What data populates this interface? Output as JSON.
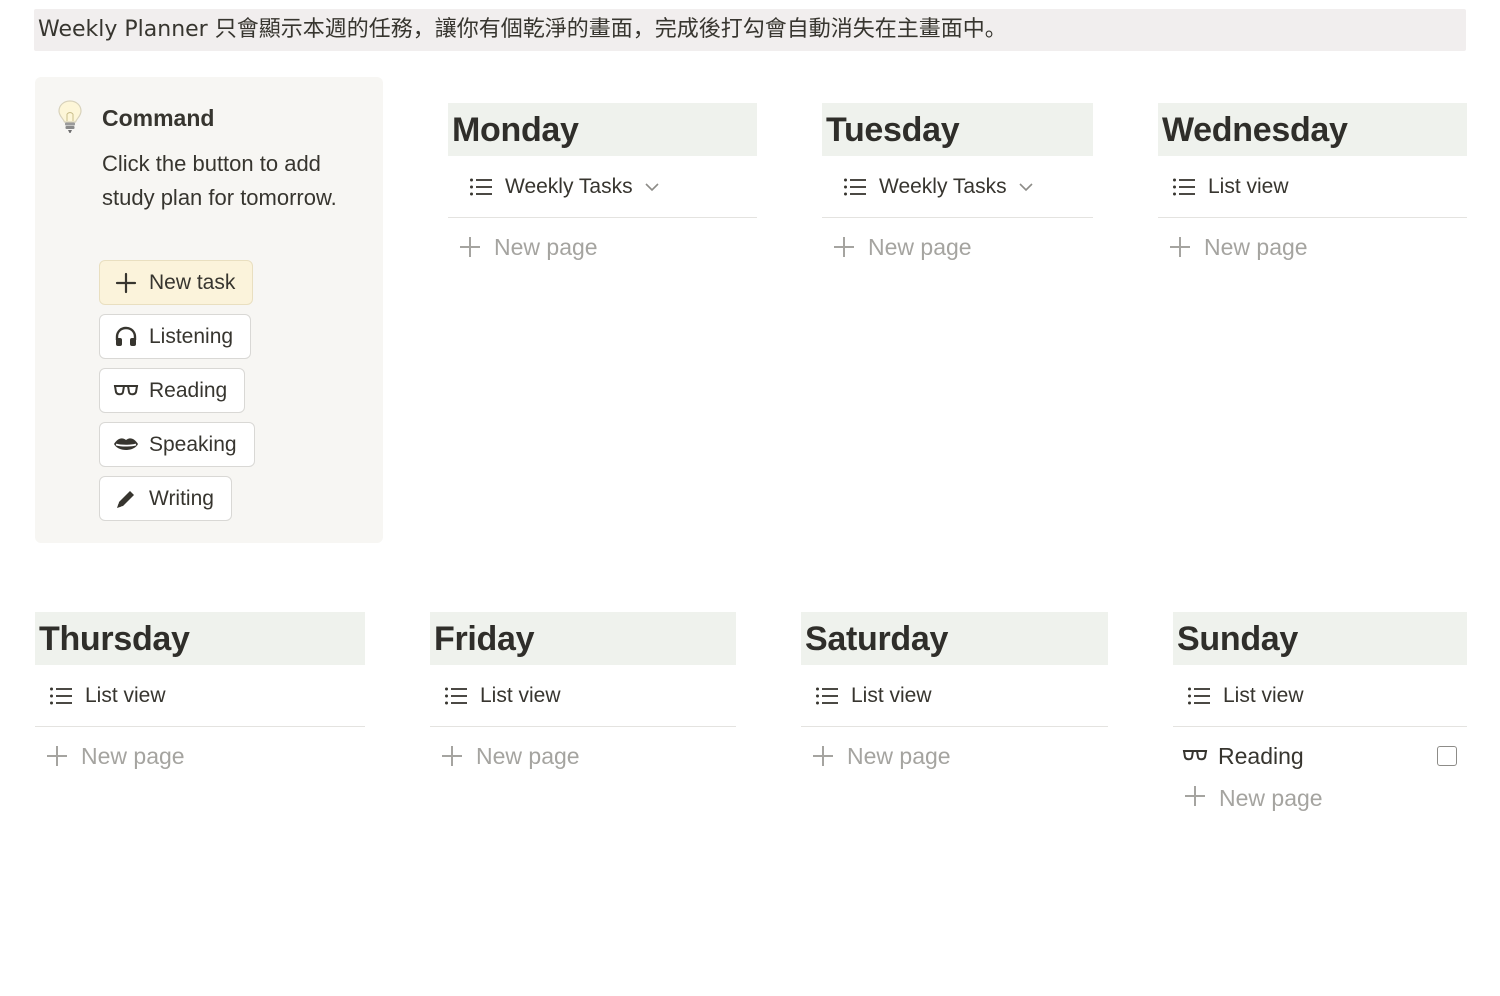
{
  "banner": {
    "text": "Weekly Planner 只會顯示本週的任務，讓你有個乾淨的畫面，完成後打勾會自動消失在主畫面中。"
  },
  "callout": {
    "icon": "lightbulb-icon",
    "title": "Command",
    "description": "Click the button to add study plan for tomorrow.",
    "buttons": [
      {
        "label": "New task",
        "icon": "plus-icon"
      },
      {
        "label": "Listening",
        "icon": "headphones-icon"
      },
      {
        "label": "Reading",
        "icon": "glasses-icon"
      },
      {
        "label": "Speaking",
        "icon": "lips-icon"
      },
      {
        "label": "Writing",
        "icon": "pencil-icon"
      }
    ]
  },
  "days": [
    {
      "name": "Monday",
      "view": "Weekly Tasks",
      "view_dropdown": true,
      "items": [],
      "new_page": "New page"
    },
    {
      "name": "Tuesday",
      "view": "Weekly Tasks",
      "view_dropdown": true,
      "items": [],
      "new_page": "New page"
    },
    {
      "name": "Wednesday",
      "view": "List view",
      "view_dropdown": false,
      "items": [],
      "new_page": "New page"
    },
    {
      "name": "Thursday",
      "view": "List view",
      "view_dropdown": false,
      "items": [],
      "new_page": "New page"
    },
    {
      "name": "Friday",
      "view": "List view",
      "view_dropdown": false,
      "items": [],
      "new_page": "New page"
    },
    {
      "name": "Saturday",
      "view": "List view",
      "view_dropdown": false,
      "items": [],
      "new_page": "New page"
    },
    {
      "name": "Sunday",
      "view": "List view",
      "view_dropdown": false,
      "items": [
        {
          "title": "Reading",
          "icon": "glasses-icon",
          "checked": false
        }
      ],
      "new_page": "New page"
    }
  ],
  "colors": {
    "banner_bg": "#f1eeee",
    "callout_bg": "#f7f6f3",
    "day_header_bg": "#eff2ed",
    "primary_button_bg": "#fbf3db",
    "placeholder_text": "#a5a4a0"
  }
}
